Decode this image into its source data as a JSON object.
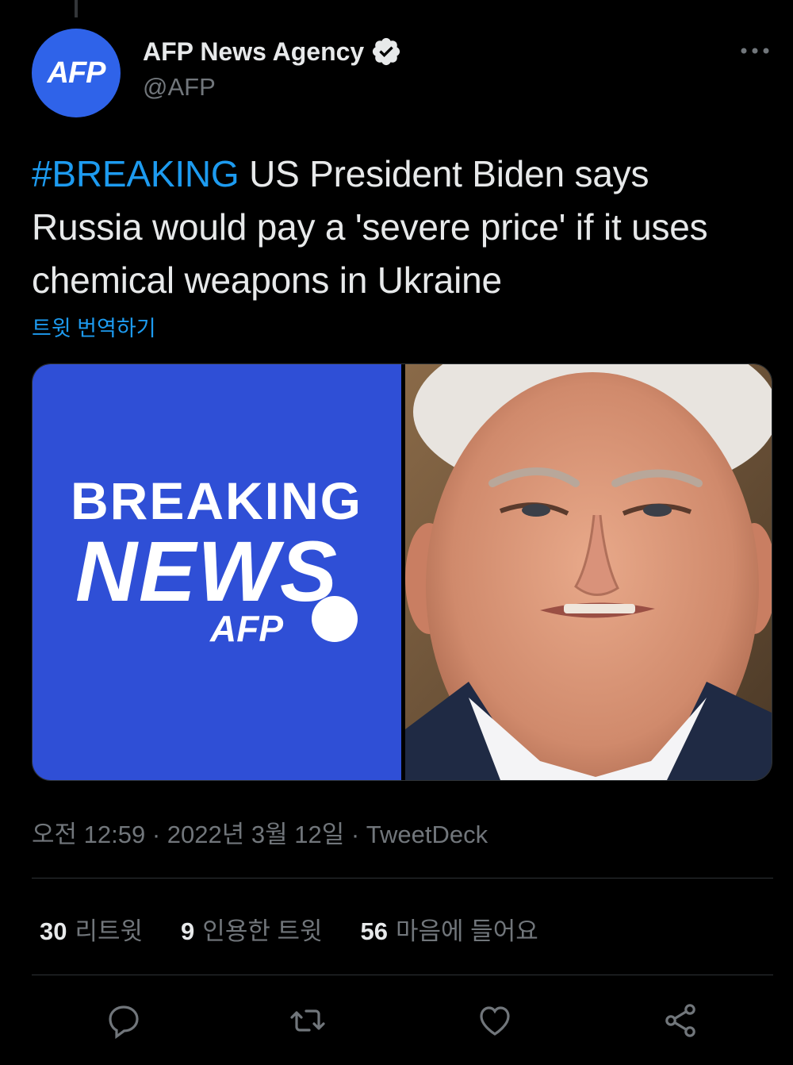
{
  "author": {
    "avatar_text": "AFP",
    "name": "AFP News Agency",
    "handle": "@AFP",
    "verified": true
  },
  "tweet": {
    "hashtag": "#BREAKING",
    "body": " US President Biden says Russia would pay a 'severe price' if it uses chemical weapons in Ukraine",
    "translate_label": "트윗 번역하기"
  },
  "media": {
    "left_image": {
      "breaking_text": "BREAKING",
      "news_text": "NEWS",
      "logo_text": "AFP",
      "background_color": "#2f4fd6"
    },
    "right_image": "photo-of-joe-biden"
  },
  "meta": {
    "time": "오전 12:59",
    "date": "2022년 3월 12일",
    "source": "TweetDeck",
    "full": "오전 12:59 · 2022년 3월 12일 · TweetDeck"
  },
  "stats": {
    "retweets_count": "30",
    "retweets_label": "리트윗",
    "quotes_count": "9",
    "quotes_label": "인용한 트윗",
    "likes_count": "56",
    "likes_label": "마음에 들어요"
  },
  "actions": [
    "reply-icon",
    "retweet-icon",
    "like-icon",
    "share-icon"
  ],
  "colors": {
    "background": "#000000",
    "text": "#e7e9ea",
    "muted": "#71767b",
    "accent": "#1d9bf0",
    "avatar": "#2f63e9"
  }
}
